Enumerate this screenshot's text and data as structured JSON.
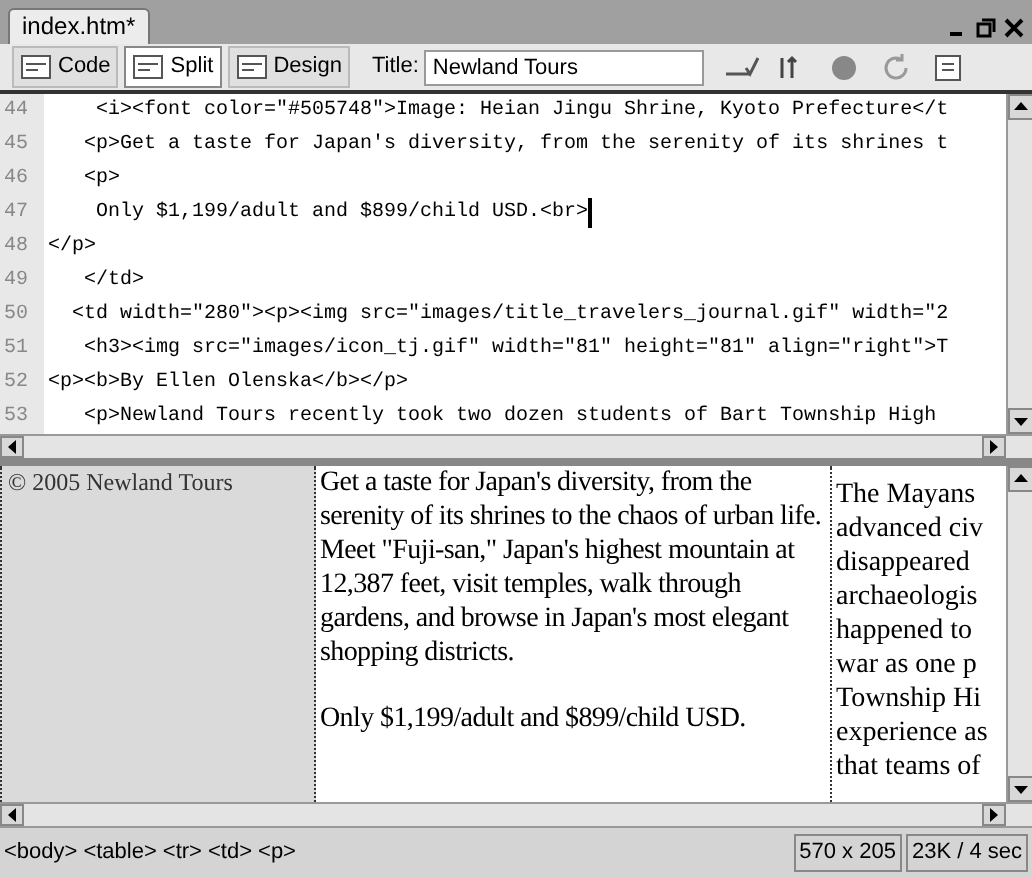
{
  "document_tab": {
    "label": "index.htm*"
  },
  "view_buttons": [
    {
      "label": "Code",
      "selected": false
    },
    {
      "label": "Split",
      "selected": true
    },
    {
      "label": "Design",
      "selected": false
    }
  ],
  "title_field": {
    "label": "Title:",
    "value": "Newland Tours"
  },
  "code_lines": [
    {
      "number": "44",
      "text": "    <i><font color=\"#505748\">Image: Heian Jingu Shrine, Kyoto Prefecture</t"
    },
    {
      "number": "45",
      "text": "   <p>Get a taste for Japan's diversity, from the serenity of its shrines t"
    },
    {
      "number": "46",
      "text": "   <p>"
    },
    {
      "number": "47",
      "text": "    Only $1,199/adult and $899/child USD.<br>",
      "cursor": true
    },
    {
      "number": "48",
      "text": "</p>"
    },
    {
      "number": "49",
      "text": "   </td>"
    },
    {
      "number": "50",
      "text": "  <td width=\"280\"><p><img src=\"images/title_travelers_journal.gif\" width=\"2"
    },
    {
      "number": "51",
      "text": "   <h3><img src=\"images/icon_tj.gif\" width=\"81\" height=\"81\" align=\"right\">T"
    },
    {
      "number": "52",
      "text": "<p><b>By Ellen Olenska</b></p>"
    },
    {
      "number": "53",
      "text": "   <p>Newland Tours recently took two dozen students of Bart Township High"
    }
  ],
  "design_view": {
    "left_cell": "© 2005 Newland Tours",
    "middle_paragraphs": [
      [
        "Get a taste for Japan's diversity, from the",
        "serenity of its shrines to the chaos of urban life.",
        "Meet \"Fuji-san,\" Japan's highest mountain at",
        "12,387 feet, visit temples, walk through",
        "gardens, and browse in Japan's most elegant",
        "shopping districts."
      ],
      [
        "Only $1,199/adult and $899/child USD."
      ]
    ],
    "right_lines": [
      "The Mayans",
      "advanced civ",
      "disappeared",
      "archaeologis",
      "happened to",
      "war as one p",
      "Township Hi",
      "experience as",
      "that teams of"
    ]
  },
  "status_bar": {
    "tags": [
      "<body>",
      "<table>",
      "<tr>",
      "<td>",
      "<p>"
    ],
    "window_size": "570 x 205",
    "download": "23K / 4 sec"
  }
}
